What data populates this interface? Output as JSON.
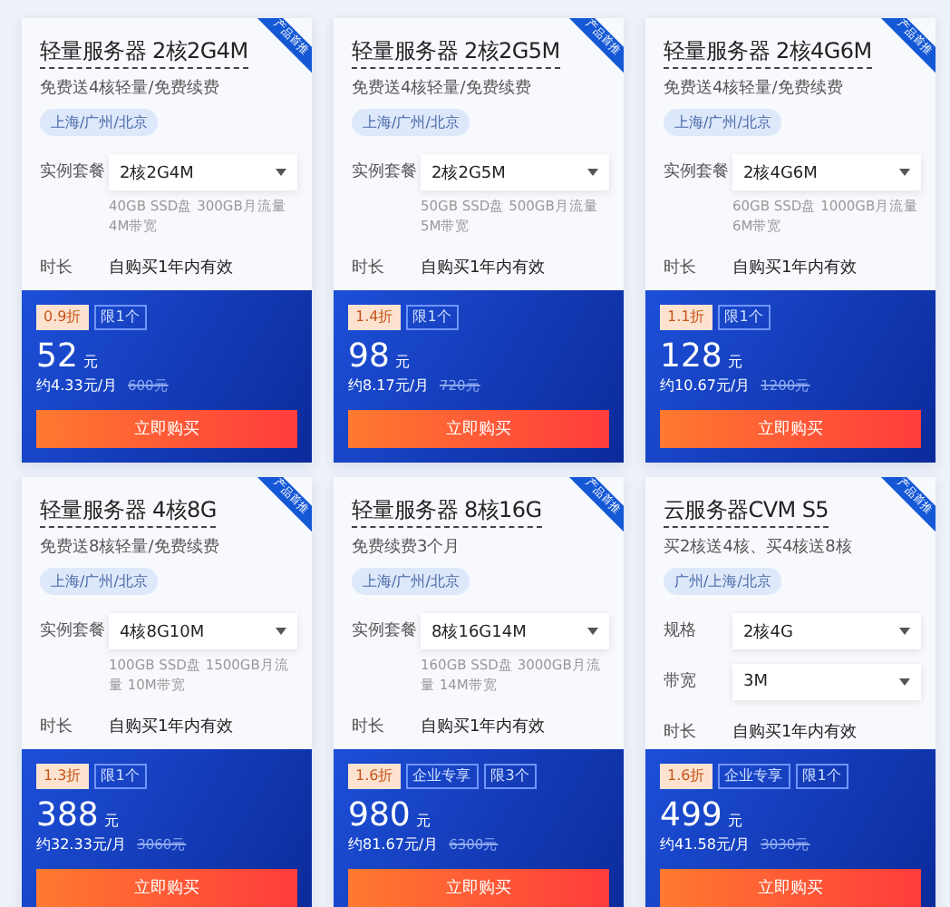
{
  "cards": [
    {
      "ribbon": "产品首推",
      "title": "轻量服务器 2核2G4M",
      "subtitle": "免费送4核轻量/免费续费",
      "region": "上海/广州/北京",
      "rows": [
        {
          "kind": "select",
          "label": "实例套餐",
          "value": "2核2G4M",
          "note": "40GB SSD盘 300GB月流量 4M带宽"
        },
        {
          "kind": "text",
          "label": "时长",
          "value": "自购买1年内有效"
        }
      ],
      "badges": [
        {
          "kind": "discount",
          "text": "0.9折"
        },
        {
          "kind": "outline",
          "text": "限1个"
        }
      ],
      "price": "52",
      "unit": "元",
      "monthly": "约4.33元/月",
      "original": "600元",
      "button": "立即购买"
    },
    {
      "ribbon": "产品首推",
      "title": "轻量服务器 2核2G5M",
      "subtitle": "免费送4核轻量/免费续费",
      "region": "上海/广州/北京",
      "rows": [
        {
          "kind": "select",
          "label": "实例套餐",
          "value": "2核2G5M",
          "note": "50GB SSD盘 500GB月流量 5M带宽"
        },
        {
          "kind": "text",
          "label": "时长",
          "value": "自购买1年内有效"
        }
      ],
      "badges": [
        {
          "kind": "discount",
          "text": "1.4折"
        },
        {
          "kind": "outline",
          "text": "限1个"
        }
      ],
      "price": "98",
      "unit": "元",
      "monthly": "约8.17元/月",
      "original": "720元",
      "button": "立即购买"
    },
    {
      "ribbon": "产品首推",
      "title": "轻量服务器 2核4G6M",
      "subtitle": "免费送4核轻量/免费续费",
      "region": "上海/广州/北京",
      "rows": [
        {
          "kind": "select",
          "label": "实例套餐",
          "value": "2核4G6M",
          "note": "60GB SSD盘 1000GB月流量 6M带宽"
        },
        {
          "kind": "text",
          "label": "时长",
          "value": "自购买1年内有效"
        }
      ],
      "badges": [
        {
          "kind": "discount",
          "text": "1.1折"
        },
        {
          "kind": "outline",
          "text": "限1个"
        }
      ],
      "price": "128",
      "unit": "元",
      "monthly": "约10.67元/月",
      "original": "1200元",
      "button": "立即购买"
    },
    {
      "ribbon": "产品首推",
      "title": "轻量服务器 4核8G",
      "subtitle": "免费送8核轻量/免费续费",
      "region": "上海/广州/北京",
      "rows": [
        {
          "kind": "select",
          "label": "实例套餐",
          "value": "4核8G10M",
          "note": "100GB SSD盘 1500GB月流量 10M带宽"
        },
        {
          "kind": "text",
          "label": "时长",
          "value": "自购买1年内有效"
        }
      ],
      "badges": [
        {
          "kind": "discount",
          "text": "1.3折"
        },
        {
          "kind": "outline",
          "text": "限1个"
        }
      ],
      "price": "388",
      "unit": "元",
      "monthly": "约32.33元/月",
      "original": "3060元",
      "button": "立即购买"
    },
    {
      "ribbon": "产品首推",
      "title": "轻量服务器 8核16G",
      "subtitle": "免费续费3个月",
      "region": "上海/广州/北京",
      "rows": [
        {
          "kind": "select",
          "label": "实例套餐",
          "value": "8核16G14M",
          "note": "160GB SSD盘 3000GB月流量 14M带宽"
        },
        {
          "kind": "text",
          "label": "时长",
          "value": "自购买1年内有效"
        }
      ],
      "badges": [
        {
          "kind": "discount",
          "text": "1.6折"
        },
        {
          "kind": "outline",
          "text": "企业专享"
        },
        {
          "kind": "outline",
          "text": "限3个"
        }
      ],
      "price": "980",
      "unit": "元",
      "monthly": "约81.67元/月",
      "original": "6300元",
      "button": "立即购买"
    },
    {
      "ribbon": "产品首推",
      "title": "云服务器CVM S5",
      "subtitle": "买2核送4核、买4核送8核",
      "region": "广州/上海/北京",
      "rows": [
        {
          "kind": "select",
          "label": "规格",
          "value": "2核4G"
        },
        {
          "kind": "select",
          "label": "带宽",
          "value": "3M"
        },
        {
          "kind": "text",
          "label": "时长",
          "value": "自购买1年内有效"
        }
      ],
      "badges": [
        {
          "kind": "discount",
          "text": "1.6折"
        },
        {
          "kind": "outline",
          "text": "企业专享"
        },
        {
          "kind": "outline",
          "text": "限1个"
        }
      ],
      "price": "499",
      "unit": "元",
      "monthly": "约41.58元/月",
      "original": "3030元",
      "button": "立即购买"
    }
  ]
}
